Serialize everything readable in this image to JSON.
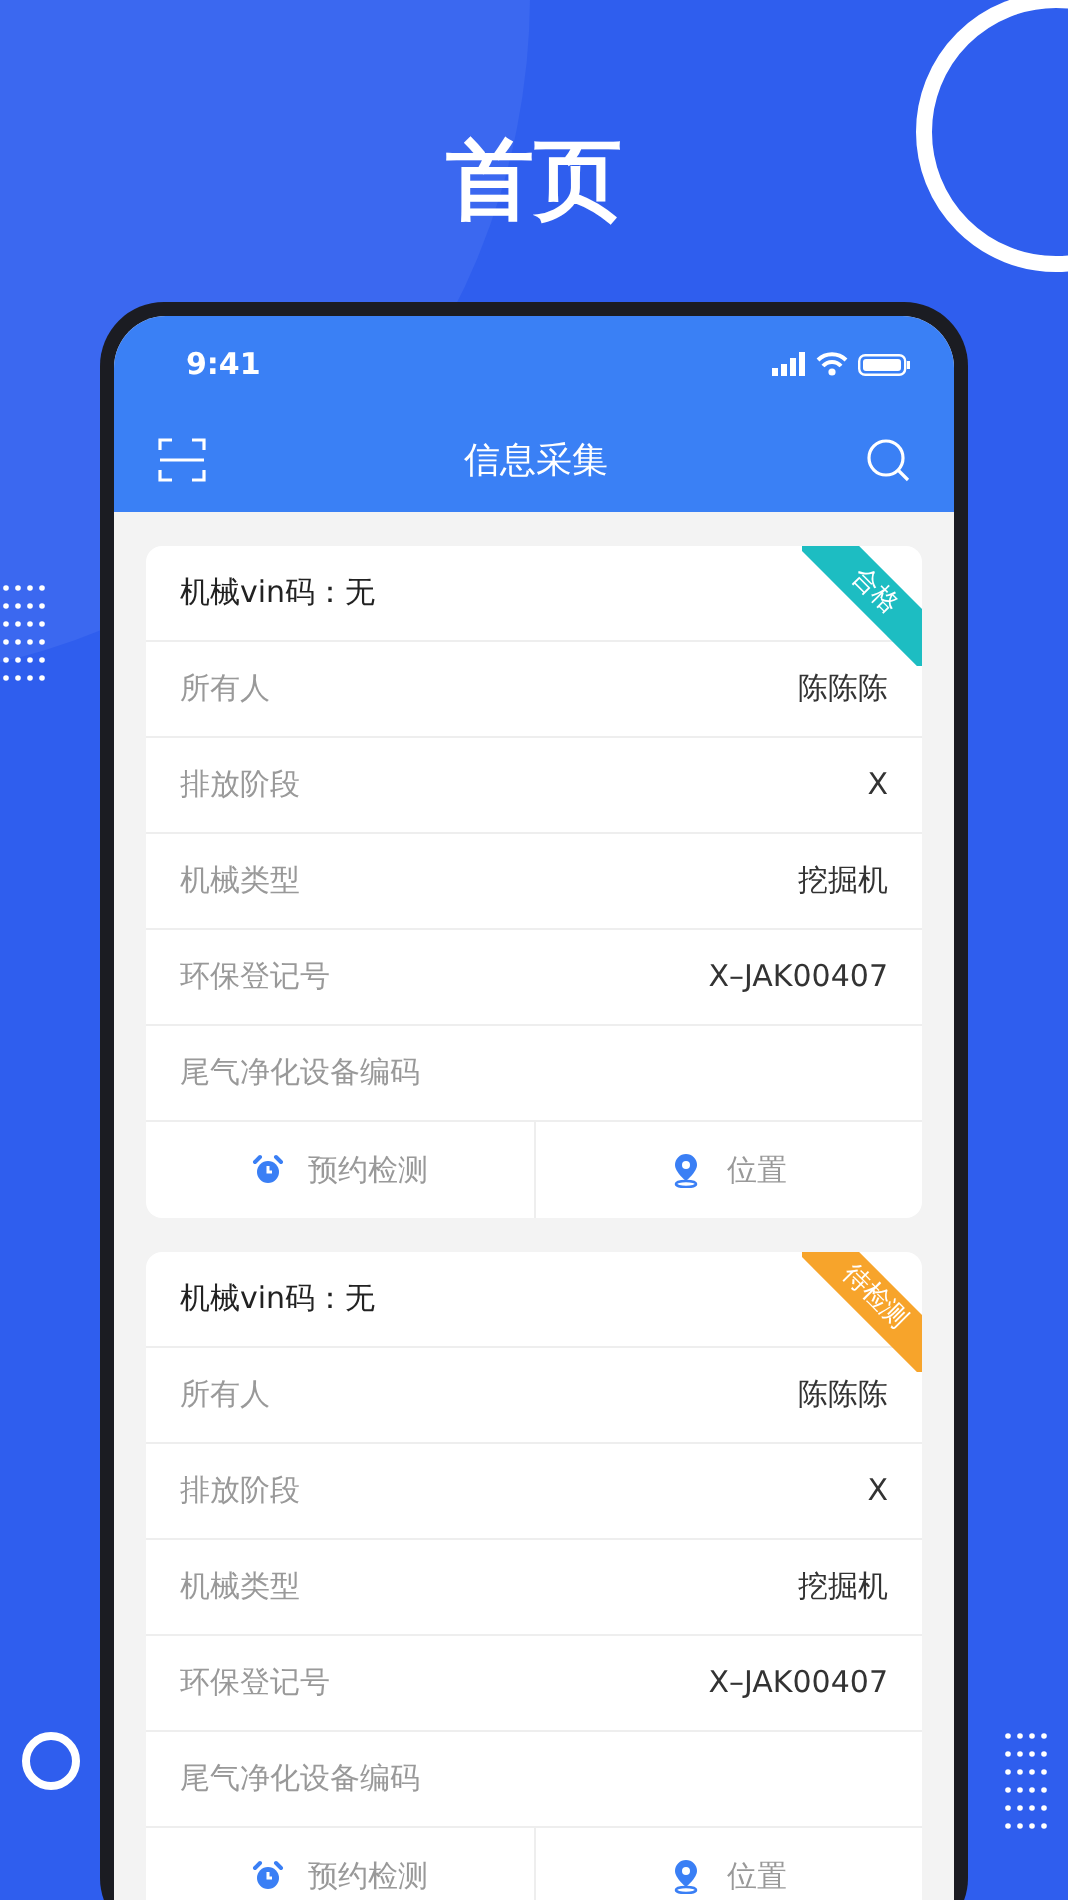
{
  "heading": "首页",
  "status_bar": {
    "time": "9:41"
  },
  "nav": {
    "title": "信息采集"
  },
  "cards": [
    {
      "vin": "机械vin码：无",
      "badge": {
        "text": "合格",
        "color": "#1dbdc2"
      },
      "fields": [
        {
          "label": "所有人",
          "value": "陈陈陈"
        },
        {
          "label": "排放阶段",
          "value": "X"
        },
        {
          "label": "机械类型",
          "value": "挖掘机"
        },
        {
          "label": "环保登记号",
          "value": "X–JAK00407"
        },
        {
          "label": "尾气净化设备编码"
        }
      ],
      "actions": [
        {
          "kind": "alarm",
          "label": "预约检测"
        },
        {
          "kind": "location",
          "label": "位置"
        }
      ]
    },
    {
      "vin": "机械vin码：无",
      "badge": {
        "text": "待检测",
        "color": "#f7a42b"
      },
      "fields": [
        {
          "label": "所有人",
          "value": "陈陈陈"
        },
        {
          "label": "排放阶段",
          "value": "X"
        },
        {
          "label": "机械类型",
          "value": "挖掘机"
        },
        {
          "label": "环保登记号",
          "value": "X–JAK00407"
        },
        {
          "label": "尾气净化设备编码"
        }
      ],
      "actions": [
        {
          "kind": "alarm",
          "label": "预约检测"
        },
        {
          "kind": "location",
          "label": "位置"
        }
      ]
    }
  ]
}
